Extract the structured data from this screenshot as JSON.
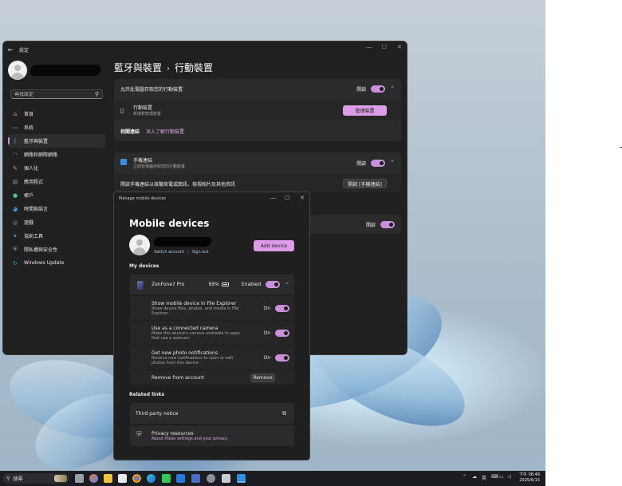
{
  "settings": {
    "window_title": "設定",
    "search_placeholder": "尋找設定",
    "nav": [
      {
        "label": "首頁",
        "icon": "home-icon",
        "color": "#e0a34b"
      },
      {
        "label": "系統",
        "icon": "monitor-icon",
        "color": "#4aa3e8"
      },
      {
        "label": "藍牙與裝置",
        "icon": "bluetooth-icon",
        "color": "#4aa3e8"
      },
      {
        "label": "網路和網際網路",
        "icon": "wifi-icon",
        "color": "#4aa3e8"
      },
      {
        "label": "個人化",
        "icon": "brush-icon",
        "color": "#e5a05b"
      },
      {
        "label": "應用程式",
        "icon": "apps-icon",
        "color": "#7d9cc9"
      },
      {
        "label": "帳戶",
        "icon": "person-icon",
        "color": "#4cc28a"
      },
      {
        "label": "時間與語言",
        "icon": "globe-clock-icon",
        "color": "#3ba2e0"
      },
      {
        "label": "遊戲",
        "icon": "gamepad-icon",
        "color": "#9aa3ad"
      },
      {
        "label": "協助工具",
        "icon": "accessibility-icon",
        "color": "#3ba2e0"
      },
      {
        "label": "隱私權與安全性",
        "icon": "shield-icon",
        "color": "#9aa3ad"
      },
      {
        "label": "Windows Update",
        "icon": "update-icon",
        "color": "#3ba2e0"
      }
    ],
    "breadcrumb_parent": "藍牙與裝置",
    "breadcrumb_sep": "›",
    "breadcrumb_current": "行動裝置",
    "card1": {
      "title": "允許此電腦存取您的行動裝置",
      "toggle_label": "開啟",
      "device_title": "行動裝置",
      "device_sub": "新增和管理裝置",
      "manage_button": "管理裝置",
      "related_label": "相關連結",
      "related_link": "深入了解行動裝置"
    },
    "card2": {
      "title": "手機連結",
      "subtitle": "立即從電腦存取您的行動裝置",
      "toggle_label": "開啟",
      "row_text": "開啟手機連結以接聽來電或簡訊、檢視相片及其他資訊",
      "open_button": "開啟 [手機連結]"
    },
    "card3": {
      "toggle_label": "開啟"
    }
  },
  "dialog": {
    "title": "Manage mobile devices",
    "heading": "Mobile devices",
    "switch_account": "Switch account",
    "sign_out": "Sign out",
    "add_device": "Add device",
    "my_devices": "My devices",
    "device_name": "ZenFone7 Pro",
    "battery": "99%",
    "enabled_label": "Enabled",
    "options": [
      {
        "title": "Show mobile device in File Explorer",
        "desc": "Show device files, photos, and media in File Explorer",
        "state": "On"
      },
      {
        "title": "Use as a connected camera",
        "desc": "Make this device's camera available to apps that use a webcam",
        "state": "On"
      },
      {
        "title": "Get new photo notifications",
        "desc": "Receive new notifications to open or edit photos from this device",
        "state": "On"
      }
    ],
    "remove_label": "Remove from account",
    "remove_button": "Remove",
    "related_links": "Related links",
    "third_party": "Third party notice",
    "privacy_title": "Privacy resources",
    "privacy_link": "About these settings and your privacy"
  },
  "taskbar": {
    "search_label": "搜尋",
    "tray_lang": "英",
    "time": "下午 08:48",
    "date": "2025/6/15"
  },
  "colors": {
    "accent": "#dd9ce8",
    "window_bg": "#202020",
    "card_bg": "#2b2b2b"
  }
}
